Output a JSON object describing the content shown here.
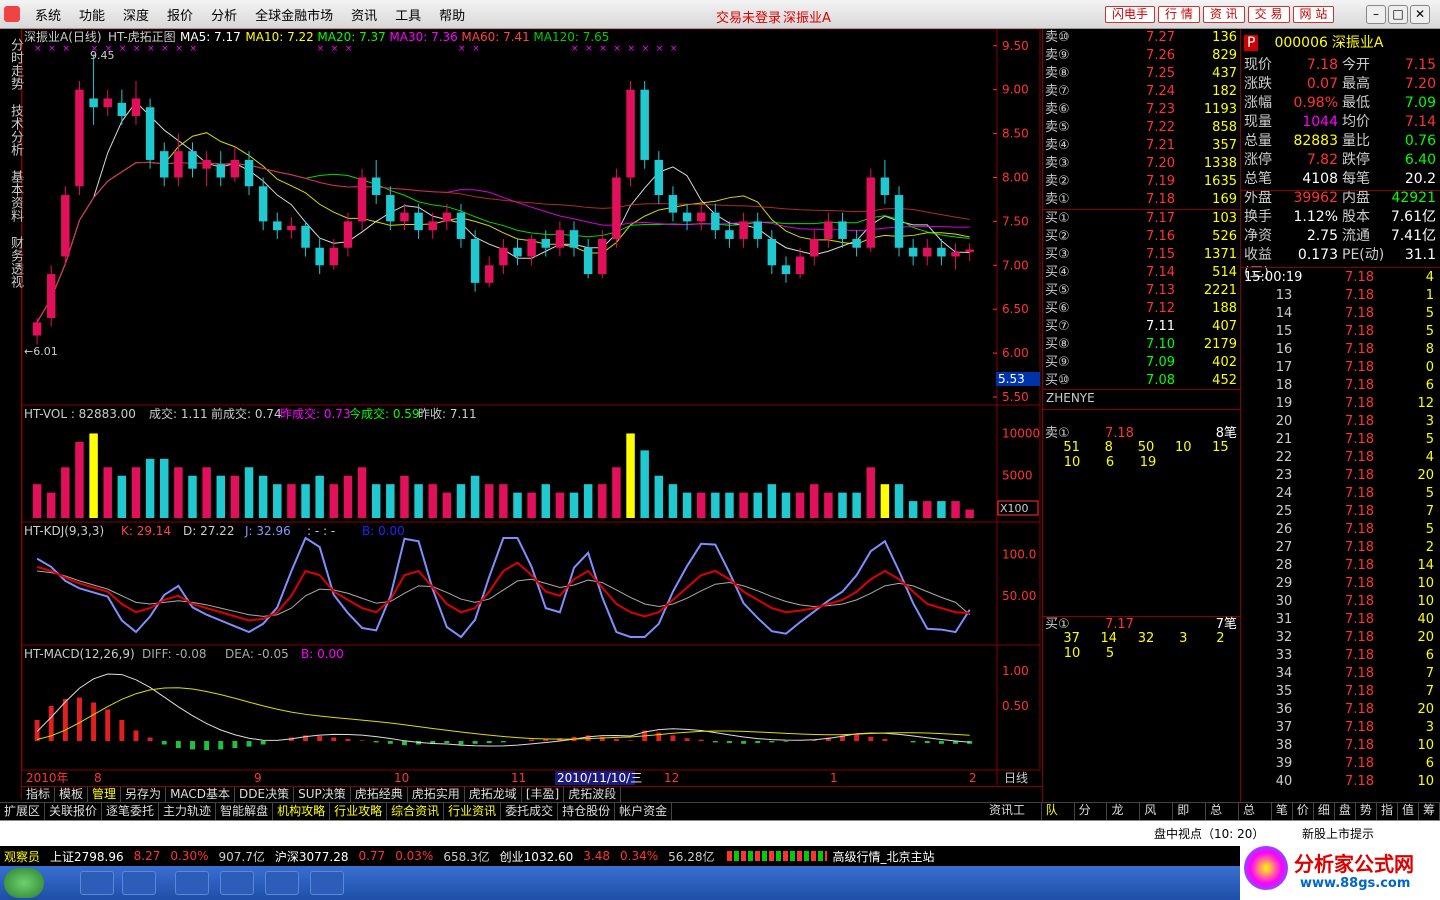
{
  "menu": [
    "系统",
    "功能",
    "深度",
    "报价",
    "分析",
    "全球金融市场",
    "资讯",
    "工具",
    "帮助"
  ],
  "login_status": "交易未登录",
  "title_stock": "深振业A",
  "quick_buttons": [
    "闪电手",
    "行 情",
    "资 讯",
    "交 易",
    "网 站"
  ],
  "left_tabs": [
    "分时走势",
    "技术分析",
    "基本资料",
    "财务透视"
  ],
  "chart": {
    "header_name": "深振业A(日线)",
    "header_indicator": "HT-虎拓正图",
    "ma": [
      {
        "label": "MA5: 7.17",
        "color": "#ffffff"
      },
      {
        "label": "MA10: 7.22",
        "color": "#ffff00"
      },
      {
        "label": "MA20: 7.37",
        "color": "#00ff00"
      },
      {
        "label": "MA30: 7.36",
        "color": "#ff00ff"
      },
      {
        "label": "MA60: 7.41",
        "color": "#ff4444"
      },
      {
        "label": "MA120: 7.65",
        "color": "#00cc00"
      }
    ],
    "price_ticks": [
      "9.50",
      "9.00",
      "8.50",
      "8.00",
      "7.50",
      "7.00",
      "6.50",
      "6.00",
      "5.50"
    ],
    "high_label": "9.45",
    "low_label": "6.01",
    "cur_price_label": "5.53",
    "vol_header": [
      {
        "t": "HT-VOL : 82883.00",
        "c": "#ccc"
      },
      {
        "t": "成交: 1.11",
        "c": "#ccc"
      },
      {
        "t": "前成交: 0.74",
        "c": "#ccc"
      },
      {
        "t": "昨成交: 0.73",
        "c": "#ff00ff"
      },
      {
        "t": "今成交: 0.59",
        "c": "#00ff00"
      },
      {
        "t": "昨收: 7.11",
        "c": "#ccc"
      }
    ],
    "vol_ticks": [
      "10000",
      "5000"
    ],
    "vol_unit": "X100",
    "kdj_header": [
      {
        "t": "HT-KDJ(9,3,3)",
        "c": "#ccc"
      },
      {
        "t": "K: 29.14",
        "c": "#ff4444"
      },
      {
        "t": "D: 27.22",
        "c": "#ccc"
      },
      {
        "t": "J: 32.96",
        "c": "#8899ff"
      },
      {
        "t": ": - : -",
        "c": "#ccc"
      },
      {
        "t": "B: 0.00",
        "c": "#2222ff"
      }
    ],
    "kdj_ticks": [
      "100.0",
      "50.00"
    ],
    "macd_header": [
      {
        "t": "HT-MACD(12,26,9)",
        "c": "#ccc"
      },
      {
        "t": "DIFF: -0.08",
        "c": "#aaa"
      },
      {
        "t": "DEA: -0.05",
        "c": "#aaa"
      },
      {
        "t": "B: 0.00",
        "c": "#ff00ff"
      }
    ],
    "macd_ticks": [
      "1.00",
      "0.50"
    ],
    "date_labels": [
      "2010年",
      "8",
      "9",
      "10",
      "11",
      "2010/11/10/三",
      "12",
      "1",
      "2"
    ],
    "period": "日线",
    "candles": [
      [
        6.2,
        6.35,
        6.1,
        6.4
      ],
      [
        6.4,
        6.9,
        6.3,
        7.0
      ],
      [
        7.1,
        7.8,
        7.0,
        7.9
      ],
      [
        7.9,
        9.0,
        7.8,
        9.1
      ],
      [
        8.9,
        8.8,
        8.6,
        9.4
      ],
      [
        8.8,
        8.9,
        8.7,
        9.0
      ],
      [
        8.85,
        8.7,
        8.6,
        9.0
      ],
      [
        8.7,
        8.9,
        8.6,
        9.1
      ],
      [
        8.8,
        8.2,
        8.1,
        8.9
      ],
      [
        8.3,
        8.0,
        7.9,
        8.4
      ],
      [
        8.0,
        8.3,
        7.9,
        8.5
      ],
      [
        8.3,
        8.1,
        8.0,
        8.4
      ],
      [
        8.1,
        8.2,
        7.9,
        8.3
      ],
      [
        8.15,
        8.0,
        7.9,
        8.3
      ],
      [
        8.0,
        8.2,
        7.95,
        8.35
      ],
      [
        8.2,
        7.9,
        7.8,
        8.3
      ],
      [
        7.9,
        7.5,
        7.4,
        8.0
      ],
      [
        7.5,
        7.4,
        7.3,
        7.6
      ],
      [
        7.4,
        7.45,
        7.3,
        7.55
      ],
      [
        7.45,
        7.2,
        7.1,
        7.5
      ],
      [
        7.2,
        7.0,
        6.9,
        7.3
      ],
      [
        7.0,
        7.2,
        6.95,
        7.3
      ],
      [
        7.2,
        7.5,
        7.1,
        7.6
      ],
      [
        7.5,
        8.0,
        7.4,
        8.1
      ],
      [
        8.0,
        7.8,
        7.7,
        8.2
      ],
      [
        7.8,
        7.5,
        7.4,
        7.9
      ],
      [
        7.5,
        7.6,
        7.4,
        7.7
      ],
      [
        7.6,
        7.4,
        7.3,
        7.7
      ],
      [
        7.4,
        7.5,
        7.3,
        7.6
      ],
      [
        7.5,
        7.6,
        7.4,
        7.7
      ],
      [
        7.6,
        7.3,
        7.2,
        7.7
      ],
      [
        7.3,
        6.8,
        6.7,
        7.4
      ],
      [
        6.8,
        7.0,
        6.75,
        7.1
      ],
      [
        7.0,
        7.2,
        6.9,
        7.3
      ],
      [
        7.2,
        7.1,
        7.0,
        7.3
      ],
      [
        7.1,
        7.3,
        7.0,
        7.35
      ],
      [
        7.3,
        7.2,
        7.1,
        7.4
      ],
      [
        7.2,
        7.4,
        7.1,
        7.5
      ],
      [
        7.4,
        7.2,
        7.1,
        7.5
      ],
      [
        7.2,
        6.9,
        6.85,
        7.3
      ],
      [
        6.9,
        7.3,
        6.85,
        7.4
      ],
      [
        7.3,
        8.0,
        7.2,
        8.1
      ],
      [
        8.0,
        9.0,
        7.9,
        9.1
      ],
      [
        9.0,
        8.2,
        8.1,
        9.1
      ],
      [
        8.2,
        7.8,
        7.7,
        8.3
      ],
      [
        7.8,
        7.6,
        7.5,
        7.9
      ],
      [
        7.6,
        7.5,
        7.4,
        7.7
      ],
      [
        7.5,
        7.6,
        7.4,
        7.7
      ],
      [
        7.6,
        7.4,
        7.3,
        7.7
      ],
      [
        7.4,
        7.3,
        7.2,
        7.5
      ],
      [
        7.3,
        7.5,
        7.2,
        7.6
      ],
      [
        7.5,
        7.3,
        7.2,
        7.6
      ],
      [
        7.3,
        7.0,
        6.9,
        7.4
      ],
      [
        7.0,
        6.9,
        6.8,
        7.1
      ],
      [
        6.9,
        7.1,
        6.85,
        7.2
      ],
      [
        7.1,
        7.3,
        7.0,
        7.4
      ],
      [
        7.3,
        7.5,
        7.2,
        7.6
      ],
      [
        7.5,
        7.3,
        7.2,
        7.6
      ],
      [
        7.3,
        7.2,
        7.1,
        7.4
      ],
      [
        7.2,
        8.0,
        7.15,
        8.1
      ],
      [
        8.0,
        7.8,
        7.7,
        8.2
      ],
      [
        7.8,
        7.2,
        7.1,
        7.9
      ],
      [
        7.2,
        7.1,
        7.0,
        7.3
      ],
      [
        7.1,
        7.2,
        7.0,
        7.3
      ],
      [
        7.2,
        7.1,
        7.0,
        7.3
      ],
      [
        7.1,
        7.15,
        6.95,
        7.25
      ],
      [
        7.15,
        7.18,
        7.05,
        7.25
      ]
    ],
    "vol": [
      4,
      3,
      6,
      9,
      10,
      6,
      5,
      6,
      7,
      7,
      6,
      5,
      6,
      5,
      5,
      6,
      5,
      4,
      4,
      4,
      5,
      4,
      5,
      6,
      4,
      4,
      5,
      4,
      4,
      3,
      4,
      5,
      4,
      4,
      3,
      3,
      4,
      3,
      3,
      4,
      4,
      6,
      10,
      8,
      5,
      4,
      3,
      3,
      3,
      3,
      3,
      3,
      4,
      3,
      3,
      4,
      3,
      3,
      3,
      6,
      4,
      4,
      2,
      2,
      2,
      2,
      1
    ],
    "kdj_k": [
      85,
      80,
      72,
      65,
      60,
      55,
      40,
      30,
      35,
      45,
      50,
      40,
      35,
      30,
      25,
      20,
      22,
      30,
      50,
      80,
      75,
      55,
      45,
      35,
      30,
      45,
      75,
      80,
      60,
      40,
      30,
      35,
      55,
      80,
      90,
      75,
      55,
      50,
      70,
      80,
      60,
      40,
      30,
      25,
      30,
      45,
      60,
      75,
      80,
      70,
      55,
      45,
      35,
      30,
      32,
      35,
      40,
      45,
      55,
      70,
      80,
      70,
      55,
      40,
      35,
      30,
      29
    ],
    "kdj_d": [
      80,
      78,
      74,
      68,
      63,
      58,
      50,
      42,
      40,
      42,
      44,
      42,
      39,
      35,
      31,
      27,
      25,
      27,
      35,
      50,
      58,
      57,
      53,
      47,
      41,
      43,
      53,
      62,
      61,
      54,
      46,
      42,
      46,
      57,
      68,
      70,
      65,
      60,
      63,
      69,
      66,
      57,
      48,
      40,
      37,
      40,
      47,
      56,
      64,
      66,
      62,
      56,
      49,
      43,
      39,
      37,
      38,
      40,
      45,
      53,
      62,
      65,
      62,
      55,
      48,
      42,
      27
    ],
    "kdj_j": [
      95,
      85,
      68,
      59,
      54,
      49,
      20,
      6,
      25,
      51,
      62,
      36,
      27,
      20,
      13,
      6,
      16,
      36,
      80,
      140,
      109,
      51,
      29,
      11,
      8,
      49,
      119,
      116,
      58,
      12,
      0,
      21,
      73,
      126,
      134,
      85,
      35,
      30,
      84,
      102,
      48,
      6,
      0,
      0,
      16,
      55,
      86,
      113,
      112,
      78,
      41,
      23,
      7,
      4,
      18,
      31,
      44,
      55,
      75,
      104,
      116,
      80,
      41,
      10,
      9,
      6,
      33
    ],
    "macd_bar": [
      0.3,
      0.5,
      0.6,
      0.62,
      0.55,
      0.45,
      0.3,
      0.15,
      0.05,
      -0.05,
      -0.1,
      -0.12,
      -0.13,
      -0.12,
      -0.1,
      -0.08,
      -0.05,
      0,
      0.05,
      0.08,
      0.07,
      0.05,
      0.03,
      0.01,
      -0.02,
      -0.04,
      -0.06,
      -0.05,
      -0.04,
      -0.03,
      -0.05,
      -0.04,
      -0.03,
      -0.02,
      0,
      0.02,
      0.03,
      0.04,
      0.06,
      0.08,
      0.06,
      0.03,
      0.01,
      0.15,
      0.12,
      0.08,
      0.04,
      0.02,
      -0.02,
      -0.03,
      -0.04,
      -0.03,
      -0.02,
      -0.01,
      0,
      0.02,
      0.05,
      0.08,
      0.1,
      0.06,
      0.03,
      0,
      -0.02,
      -0.03,
      -0.04,
      -0.04,
      -0.04
    ]
  },
  "bottom_tabs": [
    "指标",
    "模板",
    "管理",
    "另存为",
    "MACD基本",
    "DDE决策",
    "SUP决策",
    "虎拓经典",
    "虎拓实用",
    "虎拓龙域",
    "[丰盈]",
    "虎拓波段"
  ],
  "ext_tabs": [
    "扩展区",
    "关联报价",
    "逐笔委托",
    "主力轨迹",
    "智能解盘",
    "机构攻略",
    "行业攻略",
    "综合资讯",
    "行业资讯",
    "委托成交",
    "持仓股份",
    "帐户资金"
  ],
  "right_bottom_tabs": [
    "资讯工场",
    "队列",
    "分布",
    "龙虎",
    "风向",
    "即散",
    "总散",
    "总委",
    "笔",
    "价",
    "细",
    "盘",
    "势",
    "指",
    "值",
    "筹"
  ],
  "orderbook": {
    "sells": [
      [
        "卖⑩",
        "7.27",
        "136"
      ],
      [
        "卖⑨",
        "7.26",
        "829"
      ],
      [
        "卖⑧",
        "7.25",
        "437"
      ],
      [
        "卖⑦",
        "7.24",
        "182"
      ],
      [
        "卖⑥",
        "7.23",
        "1193"
      ],
      [
        "卖⑤",
        "7.22",
        "858"
      ],
      [
        "卖④",
        "7.21",
        "357"
      ],
      [
        "卖③",
        "7.20",
        "1338"
      ],
      [
        "卖②",
        "7.19",
        "1635"
      ],
      [
        "卖①",
        "7.18",
        "169"
      ]
    ],
    "buys": [
      [
        "买①",
        "7.17",
        "103"
      ],
      [
        "买②",
        "7.16",
        "526"
      ],
      [
        "买③",
        "7.15",
        "1371"
      ],
      [
        "买④",
        "7.14",
        "514"
      ],
      [
        "买⑤",
        "7.13",
        "2221"
      ],
      [
        "买⑥",
        "7.12",
        "188"
      ],
      [
        "买⑦",
        "7.11",
        "407"
      ],
      [
        "买⑧",
        "7.10",
        "2179"
      ],
      [
        "买⑨",
        "7.09",
        "402"
      ],
      [
        "买⑩",
        "7.08",
        "452"
      ]
    ],
    "zhenye": "ZHENYE",
    "sell1": {
      "label": "卖①",
      "price": "7.18",
      "count": "8笔",
      "q1": [
        "51",
        "8",
        "50",
        "10",
        "15"
      ],
      "q2": [
        "10",
        "6",
        "19"
      ]
    },
    "buy1": {
      "label": "买①",
      "price": "7.17",
      "count": "7笔",
      "q1": [
        "37",
        "14",
        "32",
        "3",
        "2"
      ],
      "q2": [
        "10",
        "5"
      ]
    }
  },
  "quote": {
    "flag": "P",
    "code": "000006",
    "name": "深振业A",
    "rows": [
      [
        "现价",
        "7.18",
        "red",
        "今开",
        "7.15",
        "red"
      ],
      [
        "涨跌",
        "0.07",
        "red",
        "最高",
        "7.20",
        "red"
      ],
      [
        "涨幅",
        "0.98%",
        "red",
        "最低",
        "7.09",
        "grn"
      ],
      [
        "现量",
        "1044",
        "mag",
        "均价",
        "7.14",
        "red"
      ],
      [
        "总量",
        "82883",
        "yel",
        "量比",
        "0.76",
        "grn"
      ],
      [
        "涨停",
        "7.82",
        "red",
        "跌停",
        "6.40",
        "grn"
      ],
      [
        "总笔",
        "4108",
        "wht",
        "每笔",
        "20.2",
        "wht"
      ],
      [
        "外盘",
        "39962",
        "red",
        "内盘",
        "42921",
        "grn"
      ],
      [
        "换手",
        "1.12%",
        "wht",
        "股本",
        "7.61亿",
        "wht"
      ],
      [
        "净资",
        "2.75",
        "wht",
        "流通",
        "7.41亿",
        "wht"
      ],
      [
        "收益(三)",
        "0.173",
        "wht",
        "PE(动)",
        "31.1",
        "wht"
      ]
    ],
    "ticks": [
      [
        "15:00:19",
        "7.18",
        "4"
      ],
      [
        "13",
        "7.18",
        "1"
      ],
      [
        "14",
        "7.18",
        "5"
      ],
      [
        "15",
        "7.18",
        "5"
      ],
      [
        "16",
        "7.18",
        "8"
      ],
      [
        "17",
        "7.18",
        "0"
      ],
      [
        "18",
        "7.18",
        "6"
      ],
      [
        "19",
        "7.18",
        "12"
      ],
      [
        "20",
        "7.18",
        "3"
      ],
      [
        "21",
        "7.18",
        "5"
      ],
      [
        "22",
        "7.18",
        "4"
      ],
      [
        "23",
        "7.18",
        "20"
      ],
      [
        "24",
        "7.18",
        "5"
      ],
      [
        "25",
        "7.18",
        "7"
      ],
      [
        "26",
        "7.18",
        "5"
      ],
      [
        "27",
        "7.18",
        "2"
      ],
      [
        "28",
        "7.18",
        "14"
      ],
      [
        "29",
        "7.18",
        "10"
      ],
      [
        "30",
        "7.18",
        "10"
      ],
      [
        "31",
        "7.18",
        "40"
      ],
      [
        "32",
        "7.18",
        "20"
      ],
      [
        "33",
        "7.18",
        "6"
      ],
      [
        "34",
        "7.18",
        "7"
      ],
      [
        "35",
        "7.18",
        "7"
      ],
      [
        "36",
        "7.18",
        "20"
      ],
      [
        "37",
        "7.18",
        "3"
      ],
      [
        "38",
        "7.18",
        "10"
      ],
      [
        "39",
        "7.18",
        "6"
      ],
      [
        "40",
        "7.18",
        "10"
      ]
    ]
  },
  "status": {
    "pan": "盘中视点（10: 20）",
    "xinggu": "新股上市提示"
  },
  "ticker": {
    "watch": "观察员",
    "sh": "上证2798.96",
    "sh_chg": "8.27",
    "sh_pct": "0.30%",
    "sh_amt": "907.7亿",
    "sz": "沪深3077.28",
    "sz_chg": "0.77",
    "sz_pct": "0.03%",
    "sz_amt": "658.3亿",
    "cy": "创业1032.60",
    "cy_chg": "3.48",
    "cy_pct": "0.34%",
    "cy_amt": "56.28亿",
    "site": "高级行情_北京主站"
  },
  "brand": {
    "name": "分析家公式网",
    "url": "www.88gs.com"
  }
}
